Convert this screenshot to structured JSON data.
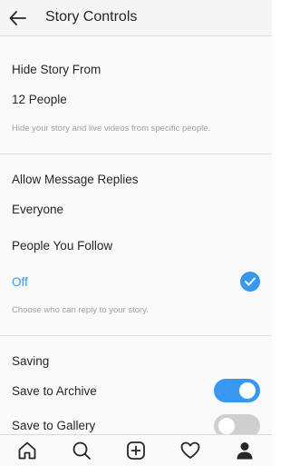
{
  "header": {
    "title": "Story Controls"
  },
  "hide_story": {
    "heading": "Hide Story From",
    "value": "12 People",
    "hint": "Hide your story and live videos from specific people."
  },
  "message_replies": {
    "heading": "Allow Message Replies",
    "options": [
      {
        "label": "Everyone",
        "selected": false
      },
      {
        "label": "People You Follow",
        "selected": false
      },
      {
        "label": "Off",
        "selected": true
      }
    ],
    "hint": "Choose who can reply to your story."
  },
  "saving": {
    "heading": "Saving",
    "archive": {
      "label": "Save to Archive",
      "on": true
    },
    "gallery": {
      "label": "Save to Gallery",
      "on": false
    }
  },
  "colors": {
    "accent": "#3897f0",
    "toggle_off": "#cfcfcf"
  },
  "tabbar": {
    "icons": [
      "home-icon",
      "search-icon",
      "add-post-icon",
      "heart-icon",
      "profile-icon"
    ]
  }
}
